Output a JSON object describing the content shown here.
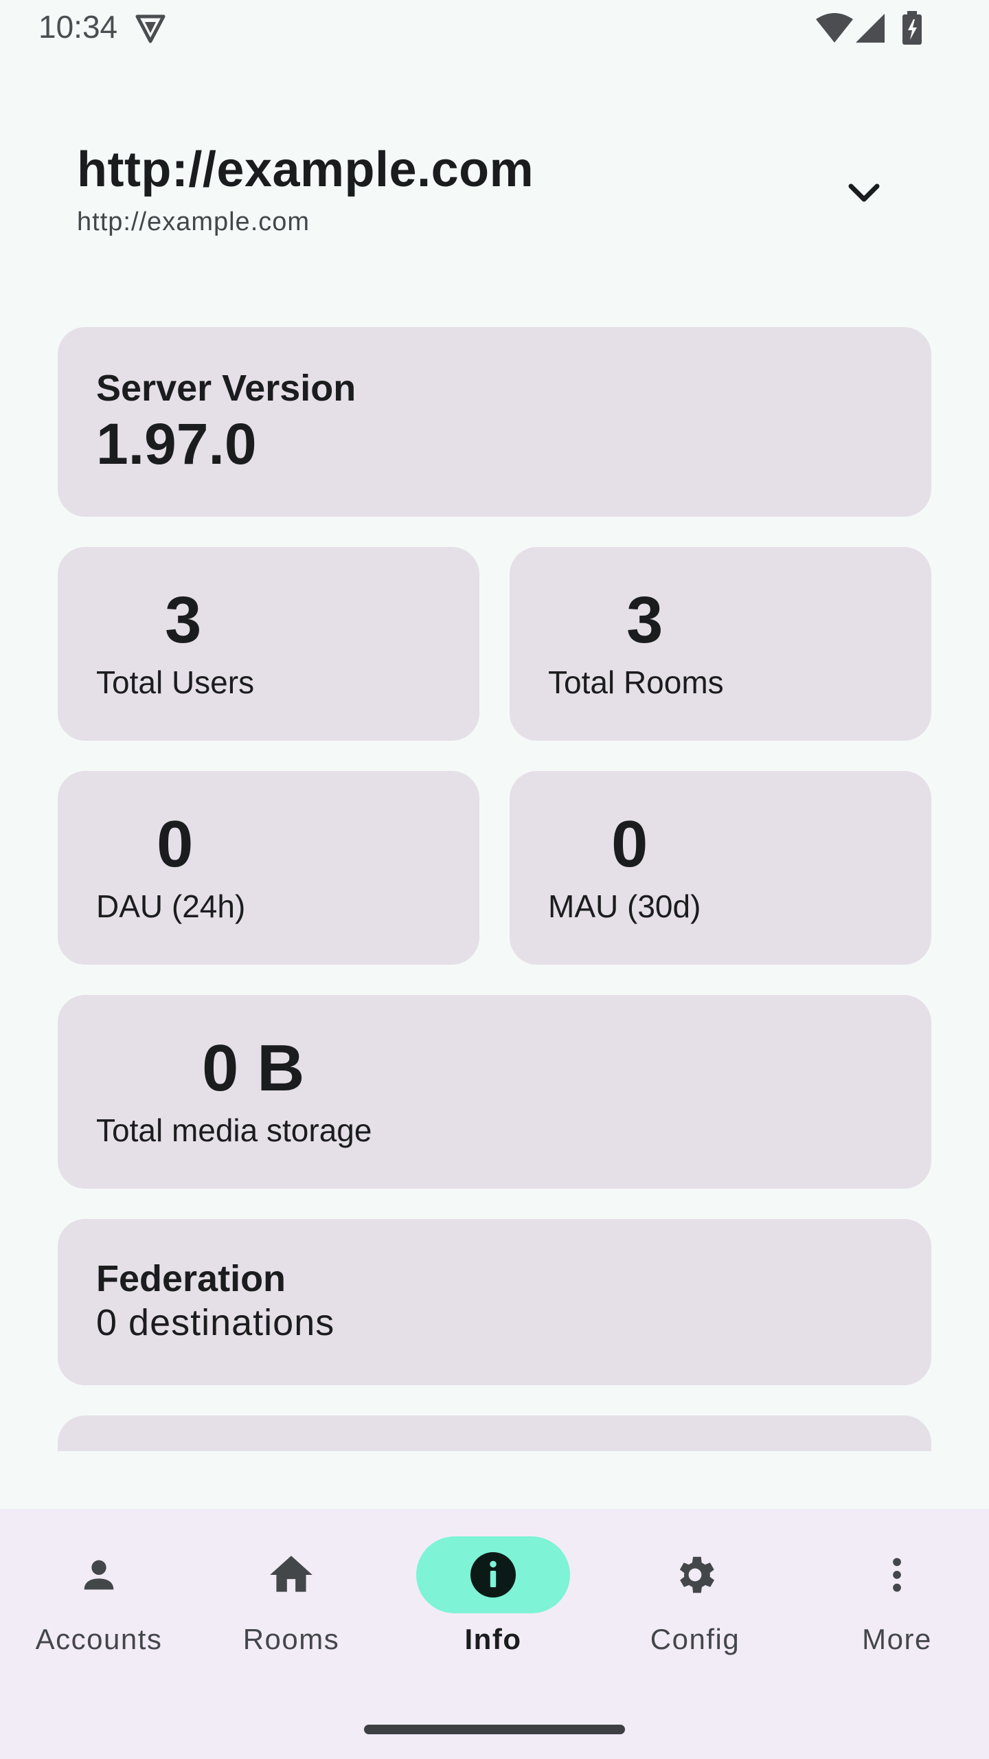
{
  "status_bar": {
    "time": "10:34",
    "icons": [
      "shield-icon",
      "wifi-icon",
      "signal-icon",
      "battery-charging-icon"
    ]
  },
  "header": {
    "title": "http://example.com",
    "subtitle": "http://example.com",
    "toggle_icon": "chevron-down-icon"
  },
  "server_version": {
    "label": "Server Version",
    "value": "1.97.0"
  },
  "stats": {
    "total_users": {
      "value": "3",
      "label": "Total Users"
    },
    "total_rooms": {
      "value": "3",
      "label": "Total Rooms"
    },
    "dau": {
      "value": "0",
      "label": "DAU (24h)"
    },
    "mau": {
      "value": "0",
      "label": "MAU (30d)"
    },
    "media_storage": {
      "value": "0 B",
      "label": "Total media storage"
    }
  },
  "federation": {
    "label": "Federation",
    "value": "0 destinations"
  },
  "nav": {
    "items": [
      {
        "label": "Accounts",
        "icon": "person-icon"
      },
      {
        "label": "Rooms",
        "icon": "home-icon"
      },
      {
        "label": "Info",
        "icon": "info-icon",
        "active": true
      },
      {
        "label": "Config",
        "icon": "gear-icon"
      },
      {
        "label": "More",
        "icon": "more-vert-icon"
      }
    ]
  },
  "colors": {
    "background": "#f5f9f8",
    "card": "#e5e0e7",
    "nav_background": "#f2ecf7",
    "active_indicator": "#7ef3d6"
  }
}
